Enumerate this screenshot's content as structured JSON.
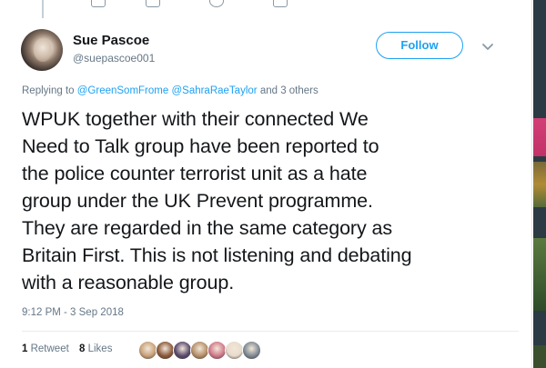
{
  "tweet": {
    "display_name": "Sue Pascoe",
    "handle": "@suepascoe001",
    "follow_label": "Follow",
    "replying_prefix": "Replying to",
    "replying_mentions": [
      "@GreenSomFrome",
      "@SahraRaeTaylor"
    ],
    "replying_suffix": "and 3 others",
    "text_lines": [
      "WPUK together with their connected We",
      "Need to Talk group have been reported to",
      "the police counter terrorist unit as a hate",
      "group under the UK Prevent programme.",
      "They are regarded in the same category as",
      "Britain First. This is not listening and debating",
      "with a reasonable group."
    ],
    "timestamp": "9:12 PM - 3 Sep 2018",
    "retweets": {
      "count": "1",
      "label": "Retweet"
    },
    "likes": {
      "count": "8",
      "label": "Likes"
    },
    "liker_avatars": [
      {
        "name": "liker-avatar-1",
        "color": "#c8a27a"
      },
      {
        "name": "liker-avatar-2",
        "color": "#8b5a3c"
      },
      {
        "name": "liker-avatar-3",
        "color": "#5a4a6e"
      },
      {
        "name": "liker-avatar-4",
        "color": "#b5906a"
      },
      {
        "name": "liker-avatar-5",
        "color": "#d07a8a"
      },
      {
        "name": "liker-avatar-6",
        "color": "#e8dccd"
      },
      {
        "name": "liker-avatar-7",
        "color": "#7e8a94"
      }
    ]
  },
  "colors": {
    "accent": "#1da1f2",
    "text": "#14171a",
    "muted": "#657786"
  },
  "icons": {
    "caret": "chevron-down-icon"
  }
}
